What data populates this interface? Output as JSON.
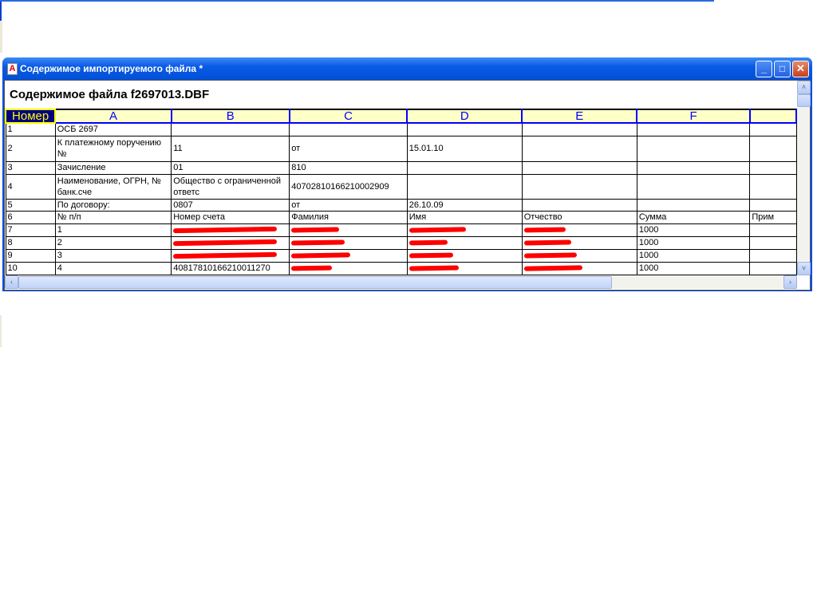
{
  "window": {
    "title": "Содержимое импортируемого файла  *",
    "minimize": "_",
    "maximize": "□",
    "close": "✕"
  },
  "heading": "Содержимое файла f2697013.DBF",
  "columns": [
    "Номер",
    "A",
    "B",
    "C",
    "D",
    "E",
    "F",
    ""
  ],
  "rows": [
    [
      "1",
      "ОСБ 2697",
      "",
      "",
      "",
      "",
      "",
      ""
    ],
    [
      "2",
      "К платежному поручению №",
      "11",
      "от",
      "15.01.10",
      "",
      "",
      ""
    ],
    [
      "3",
      "Зачисление",
      "01",
      "810",
      "",
      "",
      "",
      ""
    ],
    [
      "4",
      "Наименование, ОГРН, № банк.сче",
      "Общество с ограниченной ответс",
      "40702810166210002909",
      "",
      "",
      "",
      ""
    ],
    [
      "5",
      "По договору:",
      "0807",
      "от",
      "26.10.09",
      "",
      "",
      ""
    ],
    [
      "6",
      "№ п/п",
      "Номер счета",
      "Фамилия",
      "Имя",
      "Отчество",
      "Сумма",
      "Прим"
    ],
    [
      "7",
      "1",
      "",
      "",
      "",
      "",
      "1000",
      ""
    ],
    [
      "8",
      "2",
      "",
      "",
      "",
      "",
      "1000",
      ""
    ],
    [
      "9",
      "3",
      "",
      "",
      "",
      "",
      "1000",
      ""
    ],
    [
      "10",
      "4",
      "40817810166210011270",
      "",
      "",
      "",
      "1000",
      ""
    ]
  ],
  "redacted": [
    [
      6,
      2
    ],
    [
      6,
      3
    ],
    [
      6,
      4
    ],
    [
      6,
      5
    ],
    [
      7,
      2
    ],
    [
      7,
      3
    ],
    [
      7,
      4
    ],
    [
      7,
      5
    ],
    [
      8,
      2
    ],
    [
      8,
      3
    ],
    [
      8,
      4
    ],
    [
      8,
      5
    ],
    [
      9,
      3
    ],
    [
      9,
      4
    ],
    [
      9,
      5
    ]
  ],
  "scrollbar": {
    "up": "˄",
    "down": "˅",
    "left": "‹",
    "right": "›"
  }
}
